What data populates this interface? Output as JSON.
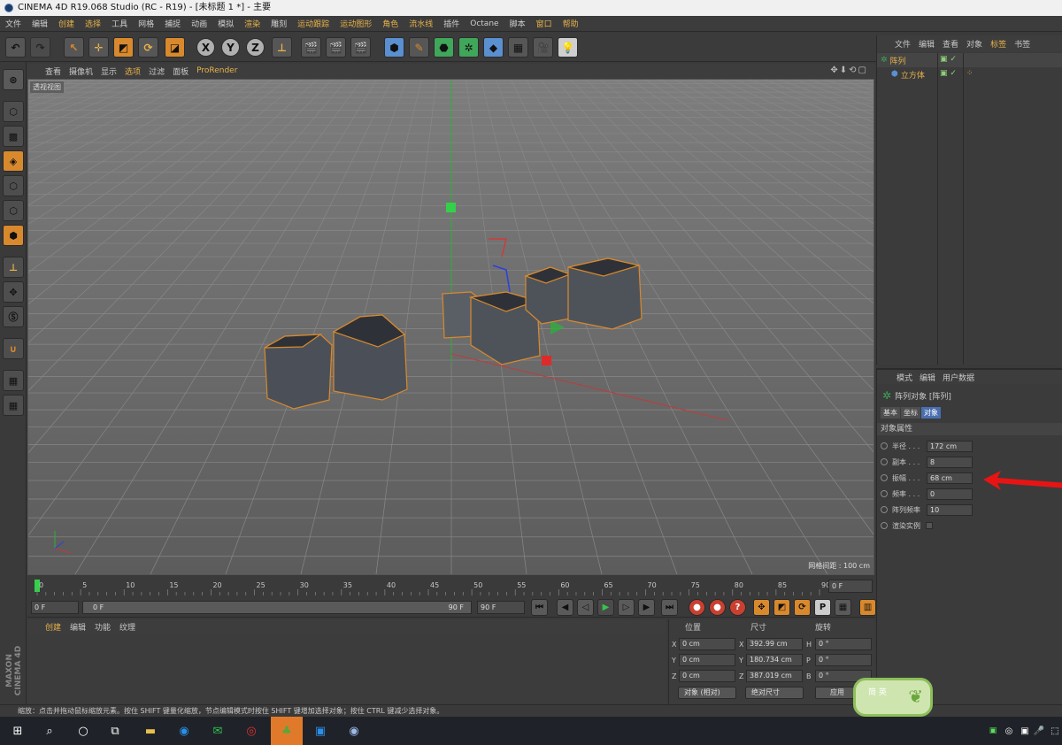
{
  "title": "CINEMA 4D R19.068 Studio (RC - R19) - [未标题 1 *] - 主要",
  "menu": [
    "文件",
    "编辑",
    "创建",
    "选择",
    "工具",
    "网格",
    "捕捉",
    "动画",
    "模拟",
    "渲染",
    "雕刻",
    "运动跟踪",
    "运动图形",
    "角色",
    "流水线",
    "插件",
    "Octane",
    "脚本",
    "窗口",
    "帮助"
  ],
  "menu_highlight": [
    2,
    3,
    9,
    11,
    12,
    13,
    14,
    18,
    19
  ],
  "viewport": {
    "tabs": [
      "查看",
      "摄像机",
      "显示",
      "选项",
      "过滤",
      "面板",
      "ProRender"
    ],
    "label": "透视视图",
    "grid_info": "网格间距 : 100 cm"
  },
  "timeline": {
    "ticks": [
      "0",
      "5",
      "10",
      "15",
      "20",
      "25",
      "30",
      "35",
      "40",
      "45",
      "50",
      "55",
      "60",
      "65",
      "70",
      "75",
      "80",
      "85",
      "90"
    ],
    "end_field": "0 F",
    "start": "0 F",
    "range_start": "0 F",
    "range_end": "90 F",
    "end": "90 F"
  },
  "material_panel": {
    "tabs": [
      "创建",
      "编辑",
      "功能",
      "纹理"
    ]
  },
  "coord_panel": {
    "headers": [
      "位置",
      "尺寸",
      "旋转"
    ],
    "rows": [
      {
        "axis": "X",
        "pos": "0 cm",
        "size_axis": "X",
        "size": "392.99 cm",
        "rot_axis": "H",
        "rot": "0 °"
      },
      {
        "axis": "Y",
        "pos": "0 cm",
        "size_axis": "Y",
        "size": "180.734 cm",
        "rot_axis": "P",
        "rot": "0 °"
      },
      {
        "axis": "Z",
        "pos": "0 cm",
        "size_axis": "Z",
        "size": "387.019 cm",
        "rot_axis": "B",
        "rot": "0 °"
      }
    ],
    "mode_dropdown": "对象 (相对)",
    "size_dropdown": "绝对尺寸",
    "apply_button": "应用"
  },
  "object_manager": {
    "tabs": [
      "文件",
      "编辑",
      "查看",
      "对象",
      "标签",
      "书签"
    ],
    "objects": [
      {
        "name": "阵列"
      },
      {
        "name": "立方体"
      }
    ]
  },
  "attribute_manager": {
    "tabs": [
      "模式",
      "编辑",
      "用户数据"
    ],
    "object_title": "阵列对象 [阵列]",
    "sub_tabs": [
      "基本",
      "坐标",
      "对象"
    ],
    "section": "对象属性",
    "properties": [
      {
        "label": "半径 . . .",
        "value": "172 cm"
      },
      {
        "label": "副本 . . .",
        "value": "8"
      },
      {
        "label": "振幅 . . .",
        "value": "68 cm"
      },
      {
        "label": "频率 . . .",
        "value": "0"
      },
      {
        "label": "阵列频率",
        "value": "10"
      },
      {
        "label": "渲染实例",
        "value": ""
      }
    ]
  },
  "statusbar": "缩放：点击并拖动鼠标缩放元素。按住 SHIFT 键量化缩放，节点编辑模式时按住 SHIFT 键增加选择对象；按住 CTRL 键减少选择对象。",
  "maxon_text": "MAXON CINEMA 4D",
  "accent_color": "#e8b24a",
  "selection_color": "#d9892d",
  "badge_text": "简 英"
}
